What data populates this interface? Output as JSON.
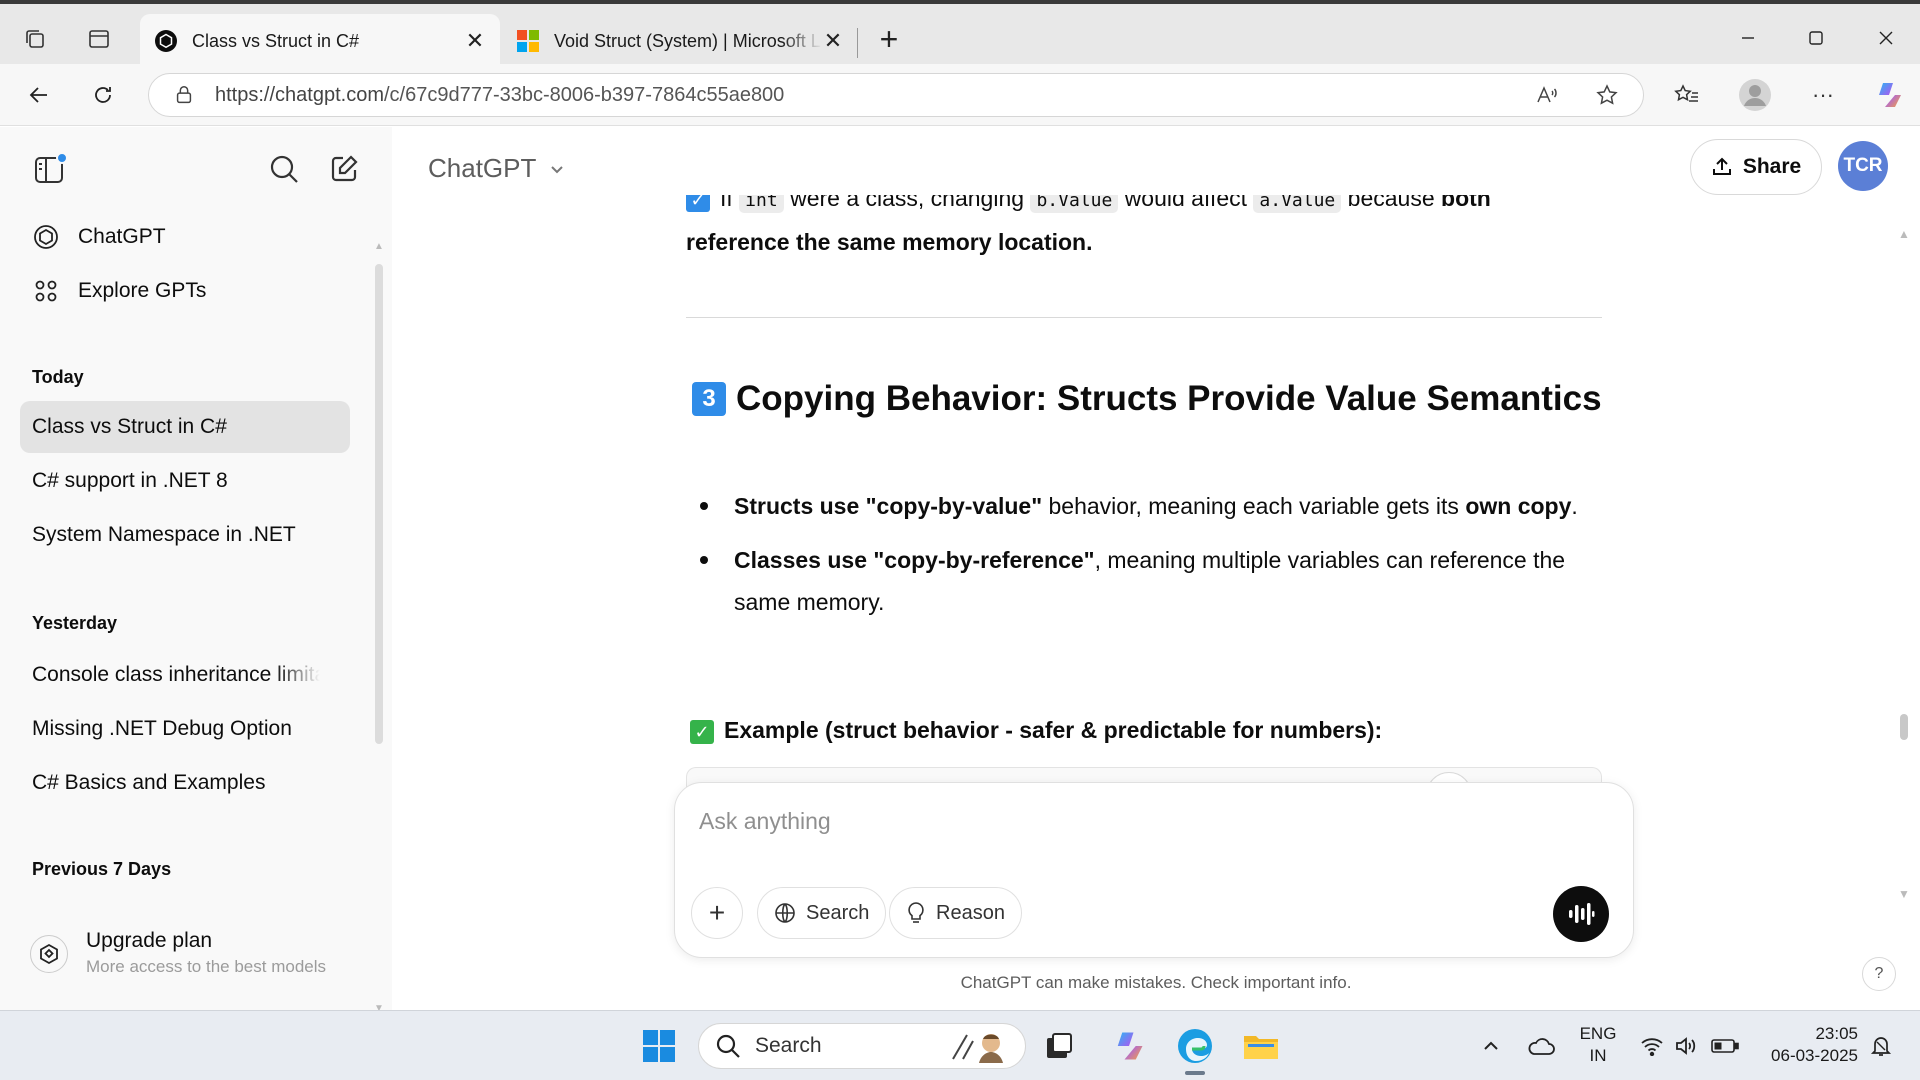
{
  "browser": {
    "tabs": [
      {
        "title": "Class vs Struct in C#",
        "active": true
      },
      {
        "title": "Void Struct (System) | Microsoft Learn",
        "active": false
      }
    ],
    "url_host": "https://chatgpt.com",
    "url_path": "/c/67c9d777-33bc-8006-b397-7864c55ae800"
  },
  "sidebar": {
    "top_items": [
      {
        "label": "ChatGPT",
        "icon": "chatgpt-logo-icon"
      },
      {
        "label": "Explore GPTs",
        "icon": "grid-icon"
      }
    ],
    "sections": [
      {
        "heading": "Today",
        "items": [
          "Class vs Struct in C#",
          "C# support in .NET 8",
          "System Namespace in .NET"
        ]
      },
      {
        "heading": "Yesterday",
        "items": [
          "Console class inheritance limitations",
          "Missing .NET Debug Option",
          "C# Basics and Examples"
        ]
      },
      {
        "heading": "Previous 7 Days",
        "items": []
      }
    ],
    "upgrade": {
      "title": "Upgrade plan",
      "subtitle": "More access to the best models"
    }
  },
  "header": {
    "model": "ChatGPT",
    "share_label": "Share",
    "avatar_initials": "TCR"
  },
  "message": {
    "clipped_line": {
      "prefix": "If ",
      "code1": "int",
      "mid1": " were a class, changing ",
      "code2": "b.Value",
      "mid2": " would affect ",
      "code3": "a.Value",
      "mid3": " because ",
      "bold": "both"
    },
    "continued_line": "reference the same memory location.",
    "heading_number": "3",
    "heading": "Copying Behavior: Structs Provide Value Semantics",
    "bullets": [
      {
        "bold1": "Structs use \"copy-by-value\"",
        "text1": " behavior, meaning each variable gets its ",
        "bold2": "own copy",
        "text2": "."
      },
      {
        "bold1": "Classes use \"copy-by-reference\"",
        "text1": ", meaning multiple variables can reference the same memory.",
        "bold2": "",
        "text2": ""
      }
    ],
    "example_label": "Example (struct behavior - safer & predictable for numbers):"
  },
  "composer": {
    "placeholder": "Ask anything",
    "search_label": "Search",
    "reason_label": "Reason"
  },
  "disclaimer": "ChatGPT can make mistakes. Check important info.",
  "help_label": "?",
  "taskbar": {
    "search_label": "Search",
    "lang_line1": "ENG",
    "lang_line2": "IN",
    "time": "23:05",
    "date": "06-03-2025"
  },
  "colors": {
    "accent_blue": "#2f8ce8",
    "check_green": "#35b34a",
    "avatar": "#5b7fd6"
  }
}
